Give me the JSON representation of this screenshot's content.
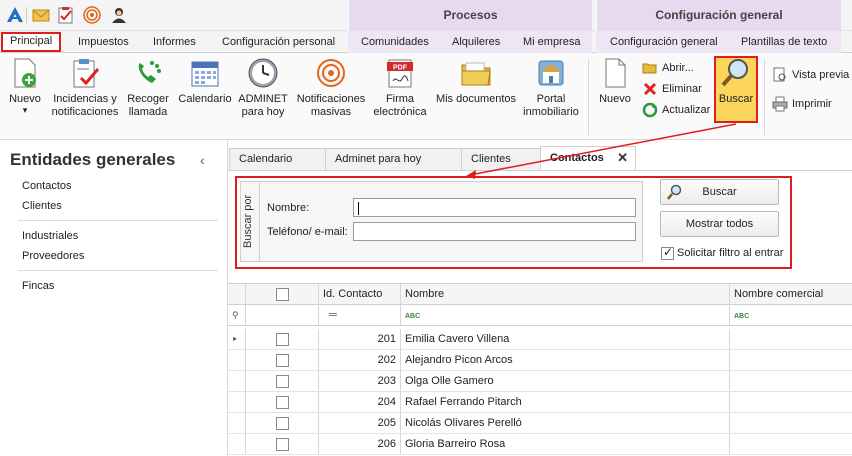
{
  "ribbon_tabs": {
    "principal": "Principal",
    "impuestos": "Impuestos",
    "informes": "Informes",
    "config_personal": "Configuración personal",
    "comunidades": "Comunidades",
    "alquileres": "Alquileres",
    "mi_empresa": "Mi empresa",
    "config_general": "Configuración general",
    "plantillas": "Plantillas de texto"
  },
  "context_groups": {
    "procesos": "Procesos",
    "configuracion": "Configuración general"
  },
  "ribbon": {
    "nuevo": "Nuevo",
    "incidencias": "Incidencias y\nnotificaciones",
    "recoger": "Recoger\nllamada",
    "calendario": "Calendario",
    "adminet": "ADMINET\npara hoy",
    "notificaciones": "Notificaciones\nmasivas",
    "firma": "Firma\nelectrónica",
    "mis_documentos": "Mis documentos",
    "portal": "Portal\ninmobiliario",
    "nuevo2": "Nuevo",
    "abrir": "Abrir...",
    "eliminar": "Eliminar",
    "actualizar": "Actualizar",
    "buscar": "Buscar",
    "vista_previa": "Vista previa",
    "imprimir": "Imprimir"
  },
  "sidebar": {
    "title": "Entidades generales",
    "items": [
      "Contactos",
      "Clientes",
      "Industriales",
      "Proveedores",
      "Fincas"
    ]
  },
  "doc_tabs": [
    "Calendario",
    "Adminet para hoy",
    "Clientes",
    "Contactos"
  ],
  "search": {
    "group_label": "Buscar por",
    "nombre_label": "Nombre:",
    "nombre_value": "",
    "telefono_label": "Teléfono/ e-mail:",
    "telefono_value": "",
    "buscar_btn": "Buscar",
    "mostrar_btn": "Mostrar todos",
    "solicitar_label": "Solicitar filtro al entrar",
    "solicitar_checked": true
  },
  "grid": {
    "columns": [
      "Id. Contacto",
      "Nombre",
      "Nombre comercial"
    ],
    "filter_eq": "═",
    "filter_abc": "ABC",
    "rows": [
      {
        "id": "201",
        "nombre": "Emilia Cavero Villena",
        "comercial": ""
      },
      {
        "id": "202",
        "nombre": "Alejandro Picon Arcos",
        "comercial": ""
      },
      {
        "id": "203",
        "nombre": "Olga Olle Gamero",
        "comercial": ""
      },
      {
        "id": "204",
        "nombre": "Rafael Ferrando Pitarch",
        "comercial": ""
      },
      {
        "id": "205",
        "nombre": "Nicolás Olivares Perelló",
        "comercial": ""
      },
      {
        "id": "206",
        "nombre": "Gloria Barreiro Rosa",
        "comercial": ""
      }
    ]
  },
  "colors": {
    "accent_red": "#e01c1c",
    "highlight_yellow": "#fbd65a",
    "context_purple": "#e7d9ee"
  }
}
